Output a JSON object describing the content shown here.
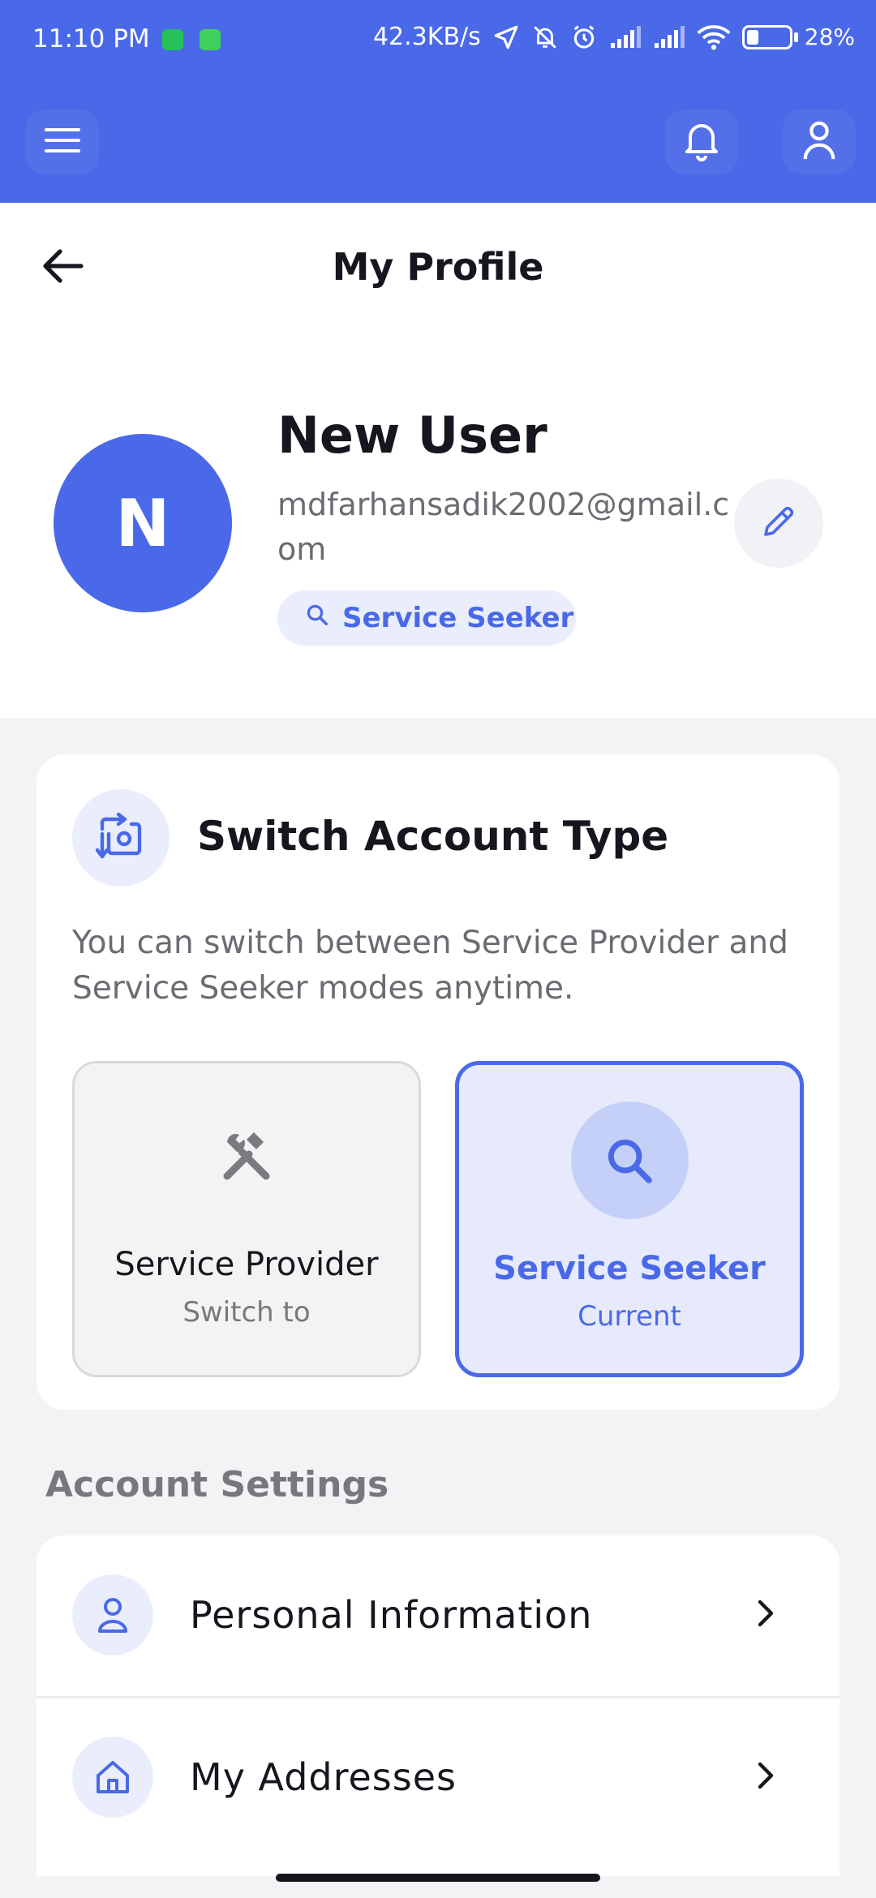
{
  "status_bar": {
    "time": "11:10 PM",
    "net_speed": "42.3KB/s",
    "battery_pct": "28%",
    "battery_level": 0.28,
    "icons": [
      "whatsapp-business-icon",
      "app-notification-icon",
      "location-arrow-icon",
      "muted-icon",
      "alarm-icon",
      "signal-icon",
      "signal-icon",
      "wifi-icon",
      "battery-icon"
    ]
  },
  "app_bar": {
    "icons": [
      "menu-icon",
      "bell-icon",
      "user-icon"
    ]
  },
  "header": {
    "title": "My Profile"
  },
  "profile": {
    "avatar_initial": "N",
    "name": "New User",
    "email": "mdfarhansadik2002@gmail.com",
    "role_chip": "Service Seeker"
  },
  "switch_account": {
    "title": "Switch Account Type",
    "description": "You can switch between Service Provider and Service Seeker modes anytime.",
    "options": [
      {
        "label": "Service Provider",
        "sub": "Switch to",
        "icon": "tools-icon",
        "selected": false
      },
      {
        "label": "Service Seeker",
        "sub": "Current",
        "icon": "search-icon",
        "selected": true
      }
    ]
  },
  "account_settings": {
    "heading": "Account Settings",
    "items": [
      {
        "label": "Personal Information",
        "icon": "person-icon"
      },
      {
        "label": "My Addresses",
        "icon": "home-icon"
      }
    ]
  },
  "colors": {
    "primary": "#4a69e8",
    "primary_soft": "#eaeefc",
    "background": "#f2f3f5",
    "text_dark": "#16161e",
    "text_muted": "#6b6b72"
  }
}
